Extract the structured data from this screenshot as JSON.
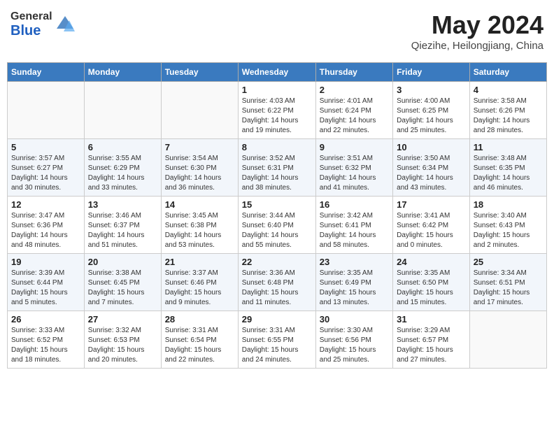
{
  "header": {
    "logo_general": "General",
    "logo_blue": "Blue",
    "month": "May 2024",
    "location": "Qiezihe, Heilongjiang, China"
  },
  "days_of_week": [
    "Sunday",
    "Monday",
    "Tuesday",
    "Wednesday",
    "Thursday",
    "Friday",
    "Saturday"
  ],
  "weeks": [
    [
      {
        "day": "",
        "info": ""
      },
      {
        "day": "",
        "info": ""
      },
      {
        "day": "",
        "info": ""
      },
      {
        "day": "1",
        "info": "Sunrise: 4:03 AM\nSunset: 6:22 PM\nDaylight: 14 hours\nand 19 minutes."
      },
      {
        "day": "2",
        "info": "Sunrise: 4:01 AM\nSunset: 6:24 PM\nDaylight: 14 hours\nand 22 minutes."
      },
      {
        "day": "3",
        "info": "Sunrise: 4:00 AM\nSunset: 6:25 PM\nDaylight: 14 hours\nand 25 minutes."
      },
      {
        "day": "4",
        "info": "Sunrise: 3:58 AM\nSunset: 6:26 PM\nDaylight: 14 hours\nand 28 minutes."
      }
    ],
    [
      {
        "day": "5",
        "info": "Sunrise: 3:57 AM\nSunset: 6:27 PM\nDaylight: 14 hours\nand 30 minutes."
      },
      {
        "day": "6",
        "info": "Sunrise: 3:55 AM\nSunset: 6:29 PM\nDaylight: 14 hours\nand 33 minutes."
      },
      {
        "day": "7",
        "info": "Sunrise: 3:54 AM\nSunset: 6:30 PM\nDaylight: 14 hours\nand 36 minutes."
      },
      {
        "day": "8",
        "info": "Sunrise: 3:52 AM\nSunset: 6:31 PM\nDaylight: 14 hours\nand 38 minutes."
      },
      {
        "day": "9",
        "info": "Sunrise: 3:51 AM\nSunset: 6:32 PM\nDaylight: 14 hours\nand 41 minutes."
      },
      {
        "day": "10",
        "info": "Sunrise: 3:50 AM\nSunset: 6:34 PM\nDaylight: 14 hours\nand 43 minutes."
      },
      {
        "day": "11",
        "info": "Sunrise: 3:48 AM\nSunset: 6:35 PM\nDaylight: 14 hours\nand 46 minutes."
      }
    ],
    [
      {
        "day": "12",
        "info": "Sunrise: 3:47 AM\nSunset: 6:36 PM\nDaylight: 14 hours\nand 48 minutes."
      },
      {
        "day": "13",
        "info": "Sunrise: 3:46 AM\nSunset: 6:37 PM\nDaylight: 14 hours\nand 51 minutes."
      },
      {
        "day": "14",
        "info": "Sunrise: 3:45 AM\nSunset: 6:38 PM\nDaylight: 14 hours\nand 53 minutes."
      },
      {
        "day": "15",
        "info": "Sunrise: 3:44 AM\nSunset: 6:40 PM\nDaylight: 14 hours\nand 55 minutes."
      },
      {
        "day": "16",
        "info": "Sunrise: 3:42 AM\nSunset: 6:41 PM\nDaylight: 14 hours\nand 58 minutes."
      },
      {
        "day": "17",
        "info": "Sunrise: 3:41 AM\nSunset: 6:42 PM\nDaylight: 15 hours\nand 0 minutes."
      },
      {
        "day": "18",
        "info": "Sunrise: 3:40 AM\nSunset: 6:43 PM\nDaylight: 15 hours\nand 2 minutes."
      }
    ],
    [
      {
        "day": "19",
        "info": "Sunrise: 3:39 AM\nSunset: 6:44 PM\nDaylight: 15 hours\nand 5 minutes."
      },
      {
        "day": "20",
        "info": "Sunrise: 3:38 AM\nSunset: 6:45 PM\nDaylight: 15 hours\nand 7 minutes."
      },
      {
        "day": "21",
        "info": "Sunrise: 3:37 AM\nSunset: 6:46 PM\nDaylight: 15 hours\nand 9 minutes."
      },
      {
        "day": "22",
        "info": "Sunrise: 3:36 AM\nSunset: 6:48 PM\nDaylight: 15 hours\nand 11 minutes."
      },
      {
        "day": "23",
        "info": "Sunrise: 3:35 AM\nSunset: 6:49 PM\nDaylight: 15 hours\nand 13 minutes."
      },
      {
        "day": "24",
        "info": "Sunrise: 3:35 AM\nSunset: 6:50 PM\nDaylight: 15 hours\nand 15 minutes."
      },
      {
        "day": "25",
        "info": "Sunrise: 3:34 AM\nSunset: 6:51 PM\nDaylight: 15 hours\nand 17 minutes."
      }
    ],
    [
      {
        "day": "26",
        "info": "Sunrise: 3:33 AM\nSunset: 6:52 PM\nDaylight: 15 hours\nand 18 minutes."
      },
      {
        "day": "27",
        "info": "Sunrise: 3:32 AM\nSunset: 6:53 PM\nDaylight: 15 hours\nand 20 minutes."
      },
      {
        "day": "28",
        "info": "Sunrise: 3:31 AM\nSunset: 6:54 PM\nDaylight: 15 hours\nand 22 minutes."
      },
      {
        "day": "29",
        "info": "Sunrise: 3:31 AM\nSunset: 6:55 PM\nDaylight: 15 hours\nand 24 minutes."
      },
      {
        "day": "30",
        "info": "Sunrise: 3:30 AM\nSunset: 6:56 PM\nDaylight: 15 hours\nand 25 minutes."
      },
      {
        "day": "31",
        "info": "Sunrise: 3:29 AM\nSunset: 6:57 PM\nDaylight: 15 hours\nand 27 minutes."
      },
      {
        "day": "",
        "info": ""
      }
    ]
  ]
}
